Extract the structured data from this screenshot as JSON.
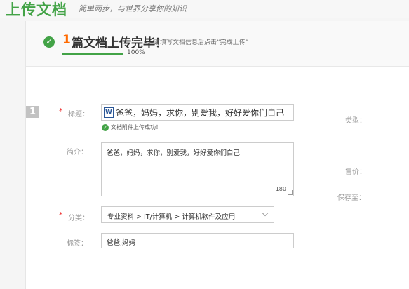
{
  "header": {
    "title": "上传文档",
    "slogan": "简单两步，与世界分享你的知识"
  },
  "status": {
    "step_number": "1",
    "title": "篇文档上传完毕！",
    "hint": "请填写文档信息后点击“完成上传”",
    "progress_percent": 100,
    "progress_text": "100%"
  },
  "document": {
    "index": "1",
    "title_label": "标题：",
    "title_value": "爸爸，妈妈，求你，别爱我，好好爱你们自己",
    "upload_status": "文档附件上传成功！",
    "summary_label": "简介：",
    "summary_value": "爸爸，妈妈，求你，别爱我，好好爱你们自己",
    "summary_char_count": "180",
    "category_label": "分类：",
    "category_value": "专业资料 > IT/计算机 > 计算机软件及应用",
    "tags_label": "标签：",
    "tags_value": "爸爸,妈妈"
  },
  "side_panel": {
    "type_label": "类型：",
    "price_label": "售价：",
    "save_to_label": "保存至："
  }
}
